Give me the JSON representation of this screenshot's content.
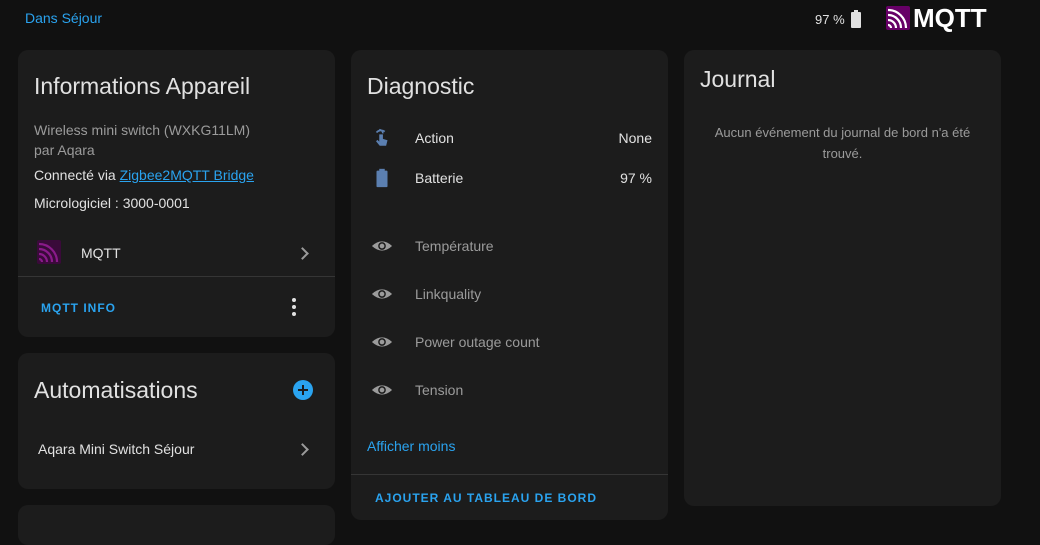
{
  "topbar": {
    "area_link": "Dans Séjour",
    "battery": "97 %",
    "logo_text": "MQTT"
  },
  "colors": {
    "accent": "#2aa3ef",
    "card_bg": "#1c1c1c",
    "page_bg": "#111111",
    "mqtt_purple": "#660066"
  },
  "device_info": {
    "title": "Informations Appareil",
    "model": "Wireless mini switch (WXKG11LM)",
    "manufacturer": "par Aqara",
    "connected_prefix": "Connecté via ",
    "connected_link": "Zigbee2MQTT Bridge",
    "firmware": "Micrologiciel : 3000-0001",
    "integration": {
      "label": "MQTT",
      "icon": "mqtt-icon"
    },
    "action_button": "MQTT INFO",
    "menu_icon": "dots-vertical-icon"
  },
  "automations": {
    "title": "Automatisations",
    "add_icon": "plus-circle-icon",
    "items": [
      {
        "label": "Aqara Mini Switch Séjour",
        "icon": "chevron-right-icon"
      }
    ]
  },
  "diagnostic": {
    "title": "Diagnostic",
    "entities": [
      {
        "label": "Action",
        "value": "None",
        "icon": "gesture-tap-icon",
        "enabled": true
      },
      {
        "label": "Batterie",
        "value": "97 %",
        "icon": "battery-icon",
        "enabled": true
      },
      {
        "label": "Température",
        "value": "",
        "icon": "eye-icon",
        "enabled": false
      },
      {
        "label": "Linkquality",
        "value": "",
        "icon": "eye-icon",
        "enabled": false
      },
      {
        "label": "Power outage count",
        "value": "",
        "icon": "eye-icon",
        "enabled": false
      },
      {
        "label": "Tension",
        "value": "",
        "icon": "eye-icon",
        "enabled": false
      }
    ],
    "show_less": "Afficher moins",
    "add_to_dashboard": "AJOUTER AU TABLEAU DE BORD"
  },
  "journal": {
    "title": "Journal",
    "empty_message": "Aucun événement du journal de bord n'a été trouvé."
  }
}
